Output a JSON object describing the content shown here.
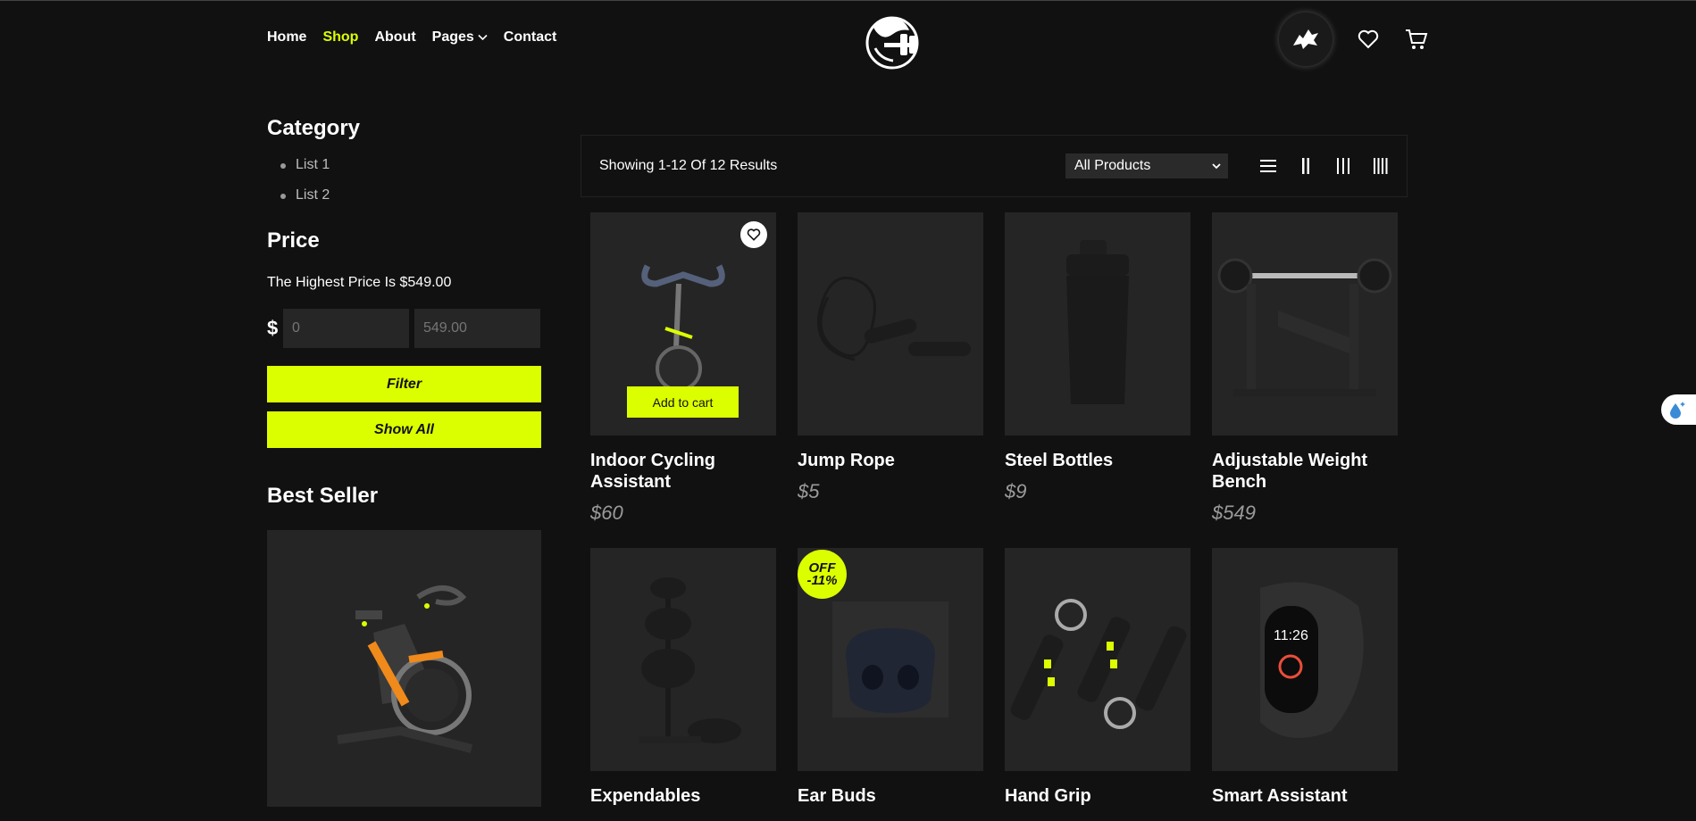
{
  "nav": {
    "items": [
      {
        "label": "Home",
        "active": false
      },
      {
        "label": "Shop",
        "active": true
      },
      {
        "label": "About",
        "active": false
      },
      {
        "label": "Pages",
        "active": false,
        "dropdown": true
      },
      {
        "label": "Contact",
        "active": false
      }
    ]
  },
  "header_icons": [
    "avatar",
    "heart-icon",
    "cart-icon"
  ],
  "sidebar": {
    "category_title": "Category",
    "categories": [
      "List 1",
      "List 2"
    ],
    "price_title": "Price",
    "price_note": "The Highest Price Is $549.00",
    "currency_symbol": "$",
    "min_placeholder": "0",
    "max_placeholder": "549.00",
    "filter_label": "Filter",
    "show_all_label": "Show All",
    "best_seller_title": "Best Seller"
  },
  "toolbar": {
    "results": "Showing 1-12 Of 12 Results",
    "select_value": "All Products",
    "views": [
      "list-view-icon",
      "grid-2-icon",
      "grid-3-icon",
      "grid-4-icon"
    ]
  },
  "products": [
    {
      "name": "Indoor Cycling Assistant",
      "price": "$60",
      "add_to_cart": "Add to cart"
    },
    {
      "name": "Jump Rope",
      "price": "$5"
    },
    {
      "name": "Steel Bottles",
      "price": "$9"
    },
    {
      "name": "Adjustable Weight Bench",
      "price": "$549"
    },
    {
      "name": "Expendables",
      "price": ""
    },
    {
      "name": "Ear Buds",
      "price": "",
      "badge_top": "OFF",
      "badge_bottom": "-11%"
    },
    {
      "name": "Hand Grip",
      "price": ""
    },
    {
      "name": "Smart Assistant",
      "price": ""
    }
  ],
  "colors": {
    "accent": "#dcff00",
    "background": "#111111",
    "card": "#252525"
  }
}
